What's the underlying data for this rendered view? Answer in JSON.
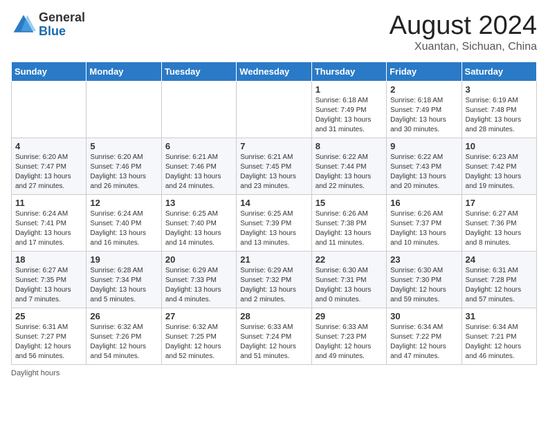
{
  "header": {
    "logo": {
      "general": "General",
      "blue": "Blue"
    },
    "title": "August 2024",
    "location": "Xuantan, Sichuan, China"
  },
  "weekdays": [
    "Sunday",
    "Monday",
    "Tuesday",
    "Wednesday",
    "Thursday",
    "Friday",
    "Saturday"
  ],
  "weeks": [
    [
      {
        "day": "",
        "info": ""
      },
      {
        "day": "",
        "info": ""
      },
      {
        "day": "",
        "info": ""
      },
      {
        "day": "",
        "info": ""
      },
      {
        "day": "1",
        "info": "Sunrise: 6:18 AM\nSunset: 7:49 PM\nDaylight: 13 hours\nand 31 minutes."
      },
      {
        "day": "2",
        "info": "Sunrise: 6:18 AM\nSunset: 7:49 PM\nDaylight: 13 hours\nand 30 minutes."
      },
      {
        "day": "3",
        "info": "Sunrise: 6:19 AM\nSunset: 7:48 PM\nDaylight: 13 hours\nand 28 minutes."
      }
    ],
    [
      {
        "day": "4",
        "info": "Sunrise: 6:20 AM\nSunset: 7:47 PM\nDaylight: 13 hours\nand 27 minutes."
      },
      {
        "day": "5",
        "info": "Sunrise: 6:20 AM\nSunset: 7:46 PM\nDaylight: 13 hours\nand 26 minutes."
      },
      {
        "day": "6",
        "info": "Sunrise: 6:21 AM\nSunset: 7:46 PM\nDaylight: 13 hours\nand 24 minutes."
      },
      {
        "day": "7",
        "info": "Sunrise: 6:21 AM\nSunset: 7:45 PM\nDaylight: 13 hours\nand 23 minutes."
      },
      {
        "day": "8",
        "info": "Sunrise: 6:22 AM\nSunset: 7:44 PM\nDaylight: 13 hours\nand 22 minutes."
      },
      {
        "day": "9",
        "info": "Sunrise: 6:22 AM\nSunset: 7:43 PM\nDaylight: 13 hours\nand 20 minutes."
      },
      {
        "day": "10",
        "info": "Sunrise: 6:23 AM\nSunset: 7:42 PM\nDaylight: 13 hours\nand 19 minutes."
      }
    ],
    [
      {
        "day": "11",
        "info": "Sunrise: 6:24 AM\nSunset: 7:41 PM\nDaylight: 13 hours\nand 17 minutes."
      },
      {
        "day": "12",
        "info": "Sunrise: 6:24 AM\nSunset: 7:40 PM\nDaylight: 13 hours\nand 16 minutes."
      },
      {
        "day": "13",
        "info": "Sunrise: 6:25 AM\nSunset: 7:40 PM\nDaylight: 13 hours\nand 14 minutes."
      },
      {
        "day": "14",
        "info": "Sunrise: 6:25 AM\nSunset: 7:39 PM\nDaylight: 13 hours\nand 13 minutes."
      },
      {
        "day": "15",
        "info": "Sunrise: 6:26 AM\nSunset: 7:38 PM\nDaylight: 13 hours\nand 11 minutes."
      },
      {
        "day": "16",
        "info": "Sunrise: 6:26 AM\nSunset: 7:37 PM\nDaylight: 13 hours\nand 10 minutes."
      },
      {
        "day": "17",
        "info": "Sunrise: 6:27 AM\nSunset: 7:36 PM\nDaylight: 13 hours\nand 8 minutes."
      }
    ],
    [
      {
        "day": "18",
        "info": "Sunrise: 6:27 AM\nSunset: 7:35 PM\nDaylight: 13 hours\nand 7 minutes."
      },
      {
        "day": "19",
        "info": "Sunrise: 6:28 AM\nSunset: 7:34 PM\nDaylight: 13 hours\nand 5 minutes."
      },
      {
        "day": "20",
        "info": "Sunrise: 6:29 AM\nSunset: 7:33 PM\nDaylight: 13 hours\nand 4 minutes."
      },
      {
        "day": "21",
        "info": "Sunrise: 6:29 AM\nSunset: 7:32 PM\nDaylight: 13 hours\nand 2 minutes."
      },
      {
        "day": "22",
        "info": "Sunrise: 6:30 AM\nSunset: 7:31 PM\nDaylight: 13 hours\nand 0 minutes."
      },
      {
        "day": "23",
        "info": "Sunrise: 6:30 AM\nSunset: 7:30 PM\nDaylight: 12 hours\nand 59 minutes."
      },
      {
        "day": "24",
        "info": "Sunrise: 6:31 AM\nSunset: 7:28 PM\nDaylight: 12 hours\nand 57 minutes."
      }
    ],
    [
      {
        "day": "25",
        "info": "Sunrise: 6:31 AM\nSunset: 7:27 PM\nDaylight: 12 hours\nand 56 minutes."
      },
      {
        "day": "26",
        "info": "Sunrise: 6:32 AM\nSunset: 7:26 PM\nDaylight: 12 hours\nand 54 minutes."
      },
      {
        "day": "27",
        "info": "Sunrise: 6:32 AM\nSunset: 7:25 PM\nDaylight: 12 hours\nand 52 minutes."
      },
      {
        "day": "28",
        "info": "Sunrise: 6:33 AM\nSunset: 7:24 PM\nDaylight: 12 hours\nand 51 minutes."
      },
      {
        "day": "29",
        "info": "Sunrise: 6:33 AM\nSunset: 7:23 PM\nDaylight: 12 hours\nand 49 minutes."
      },
      {
        "day": "30",
        "info": "Sunrise: 6:34 AM\nSunset: 7:22 PM\nDaylight: 12 hours\nand 47 minutes."
      },
      {
        "day": "31",
        "info": "Sunrise: 6:34 AM\nSunset: 7:21 PM\nDaylight: 12 hours\nand 46 minutes."
      }
    ]
  ],
  "footer": {
    "daylight_label": "Daylight hours"
  }
}
